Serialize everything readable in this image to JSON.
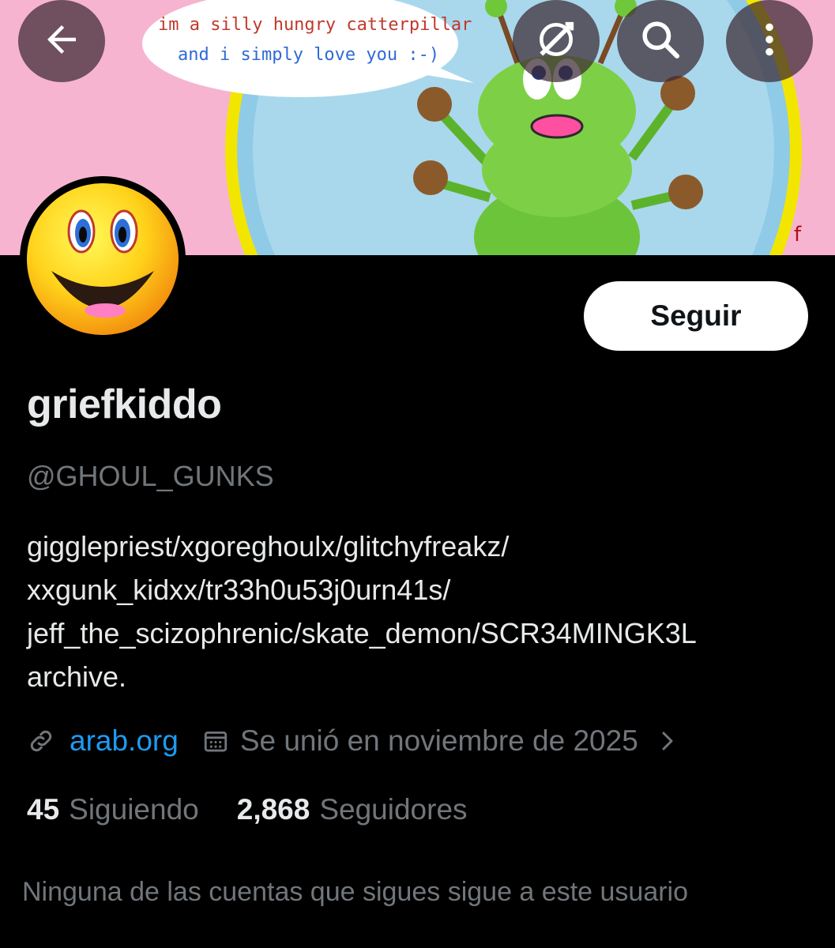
{
  "header": {
    "banner_caption_line1": "im a silly hungry catterpillar",
    "banner_caption_line2": "and i simply love you :-)",
    "back_icon": "arrow-left-icon",
    "feed_icon": "no-feed-icon",
    "search_icon": "search-icon",
    "more_icon": "more-vertical-icon"
  },
  "profile": {
    "follow_label": "Seguir",
    "display_name": "griefkiddo",
    "handle": "@GHOUL_GUNKS",
    "bio_lines": [
      "gigglepriest/xgoreghoulx/glitchyfreakz/",
      "xxgunk_kidxx/tr33h0u53j0urn41s/",
      "jeff_the_scizophrenic/skate_demon/SCR34MINGK3L",
      "archive."
    ],
    "website": "arab.org",
    "joined": "Se unió en noviembre de 2025",
    "following_count": "45",
    "following_label": "Siguiendo",
    "followers_count": "2,868",
    "followers_label": "Seguidores",
    "no_mutual_text": "Ninguna de las cuentas que sigues sigue a este usuario"
  },
  "colors": {
    "background": "#000000",
    "primary_text": "#e7e9ea",
    "secondary_text": "#71767b",
    "link": "#1d9bf0",
    "button_bg": "#ffffff",
    "button_text": "#0f1419"
  }
}
